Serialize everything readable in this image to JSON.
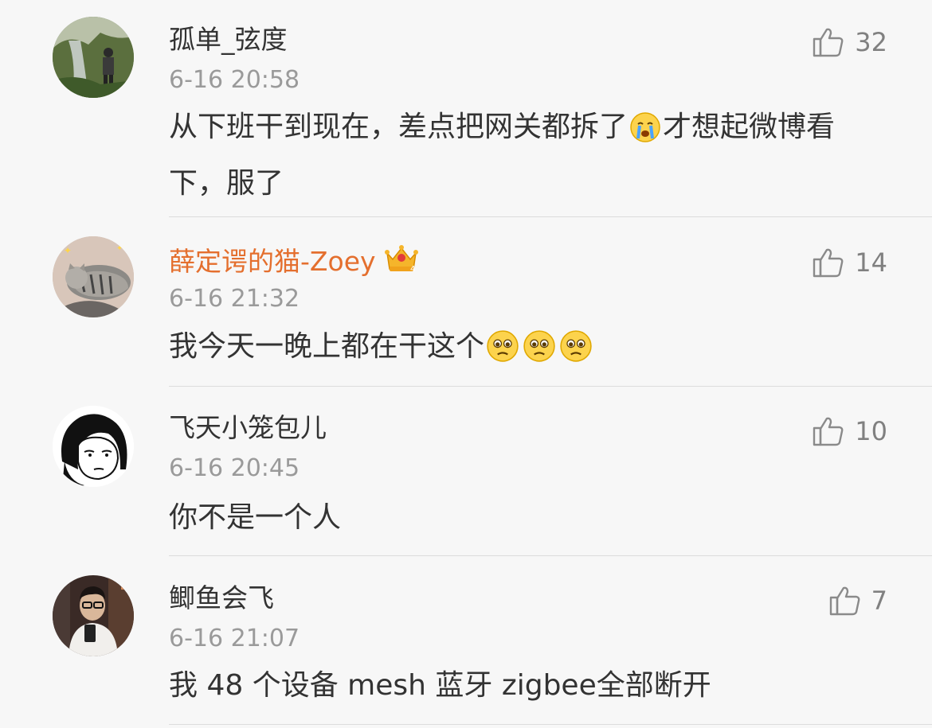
{
  "comments": [
    {
      "username": "孤单_弦度",
      "time": "6-16 20:58",
      "likes": "32",
      "text_before": "从下班干到现在，差点把网关都拆了",
      "emoji": "crying-emoji",
      "text_after": "才想起微博看下，服了"
    },
    {
      "username": "薛定谔的猫-Zoey",
      "username_color": "#e46f2e",
      "badge": "crown-vip-icon",
      "time": "6-16 21:32",
      "likes": "14",
      "text": "我今天一晚上都在干这个",
      "emoji": "pleading-emoji"
    },
    {
      "username": "飞天小笼包儿",
      "time": "6-16 20:45",
      "likes": "10",
      "text": "你不是一个人"
    },
    {
      "username": "鲫鱼会飞",
      "time": "6-16 21:07",
      "likes": "7",
      "text": "我 48 个设备 mesh 蓝牙 zigbee全部断开"
    }
  ],
  "colors": {
    "background": "#f7f7f7",
    "vip_name": "#e46f2e",
    "meta": "#9a9a9a",
    "text": "#333333"
  }
}
